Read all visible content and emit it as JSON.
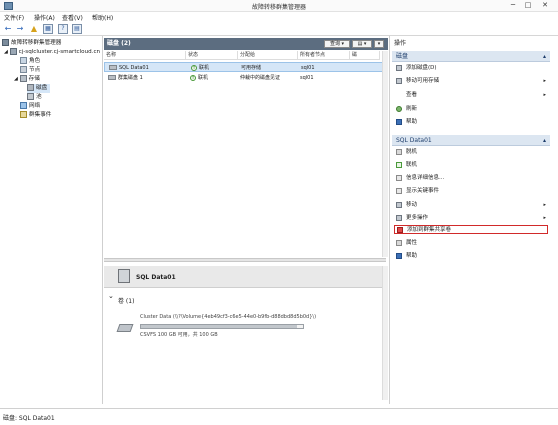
{
  "window": {
    "title": "故障转移群集管理器",
    "minimize": "─",
    "restore": "□",
    "close": "✕"
  },
  "menu": [
    "文件(F)",
    "操作(A)",
    "查看(V)",
    "帮助(H)"
  ],
  "toolbar": {
    "back": "←",
    "forward": "→",
    "up": "▲",
    "show_hide": "▦",
    "help": "?",
    "properties": "▤",
    "icons": [
      "back-icon",
      "forward-icon",
      "up-folder-icon",
      "show-hide-tree-icon",
      "help-icon",
      "properties-icon"
    ]
  },
  "tree": {
    "root": "故障转移群集管理器",
    "cluster": "cj-sqlcluster.cj-smartcloud.cn",
    "roles": "角色",
    "nodes": "节点",
    "storage": "存储",
    "disks": "磁盘",
    "pools": "池",
    "networks": "网络",
    "events": "群集事件"
  },
  "center": {
    "header": "磁盘 (2)",
    "query": "查询",
    "save_glyph": "▾",
    "dropdown_glyph": "▾",
    "columns": [
      "名称",
      "状态",
      "分配给",
      "所有者节点",
      "磁"
    ],
    "rows": [
      {
        "name": "SQL Data01",
        "status": "联机",
        "assigned": "可用存储",
        "owner": "sql01",
        "selected": true
      },
      {
        "name": "群集磁盘 1",
        "status": "联机",
        "assigned": "仲裁中的磁盘见证",
        "owner": "sql01",
        "selected": false
      }
    ]
  },
  "detail": {
    "title": "SQL Data01",
    "expand": "⌄",
    "volumes_label": "卷 (1)",
    "volume_path": "Cluster Data (\\\\?\\Volume{4eb49cf3-c6e5-44e0-b9fb-d88dbd8d5b0d}\\)",
    "volume_usage": "CSVFS 100 GB 可用，共 100 GB",
    "usage_fraction": 0.96
  },
  "actions": {
    "title": "操作",
    "section1": "磁盘",
    "section1_items": [
      {
        "label": "添加磁盘(D)",
        "icon": "add-disk-icon",
        "submenu": false
      },
      {
        "label": "移动可用存储",
        "icon": "move-storage-icon",
        "submenu": true
      },
      {
        "label": "查看",
        "icon": "view-icon",
        "submenu": true
      },
      {
        "label": "刷新",
        "icon": "refresh-icon",
        "submenu": false
      },
      {
        "label": "帮助",
        "icon": "help-icon",
        "submenu": false
      }
    ],
    "section2": "SQL Data01",
    "section2_items": [
      {
        "label": "脱机",
        "icon": "offline-icon",
        "submenu": false,
        "highlight": false
      },
      {
        "label": "联机",
        "icon": "online-icon",
        "submenu": false,
        "highlight": false
      },
      {
        "label": "信息详细信息...",
        "icon": "info-icon",
        "submenu": false,
        "highlight": false
      },
      {
        "label": "显示关键事件",
        "icon": "critical-events-icon",
        "submenu": false,
        "highlight": false
      },
      {
        "label": "移动",
        "icon": "move-icon",
        "submenu": true,
        "highlight": false
      },
      {
        "label": "更多操作",
        "icon": "more-actions-icon",
        "submenu": true,
        "highlight": false
      },
      {
        "label": "添加到群集共享卷",
        "icon": "add-to-csv-icon",
        "submenu": false,
        "highlight": true
      },
      {
        "label": "属性",
        "icon": "properties-icon",
        "submenu": false,
        "highlight": false
      },
      {
        "label": "帮助",
        "icon": "help-icon",
        "submenu": false,
        "highlight": false
      }
    ],
    "arrow": "▸",
    "caret": "▴"
  },
  "status": {
    "text": "磁盘: SQL Data01"
  }
}
